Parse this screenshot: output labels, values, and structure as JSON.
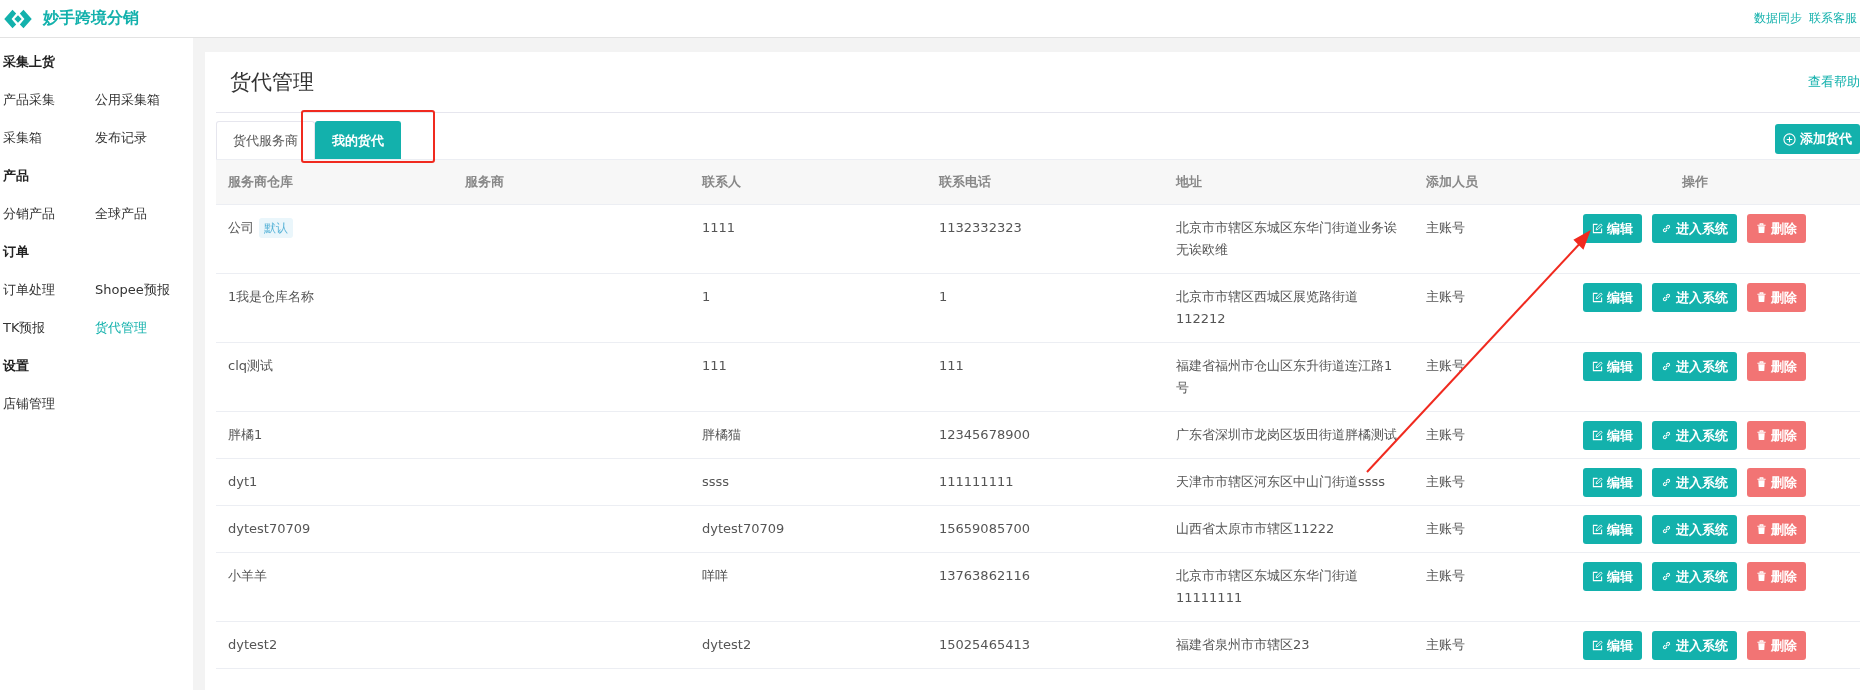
{
  "header": {
    "brand": "妙手跨境分销",
    "links": [
      "数据同步",
      "联系客服"
    ]
  },
  "sidebar": [
    {
      "title": "采集上货",
      "items": [
        {
          "label": "产品采集",
          "selected": false
        },
        {
          "label": "公用采集箱",
          "selected": false
        },
        {
          "label": "采集箱",
          "selected": false
        },
        {
          "label": "发布记录",
          "selected": false
        }
      ]
    },
    {
      "title": "产品",
      "items": [
        {
          "label": "分销产品",
          "selected": false
        },
        {
          "label": "全球产品",
          "selected": false
        }
      ]
    },
    {
      "title": "订单",
      "items": [
        {
          "label": "订单处理",
          "selected": false
        },
        {
          "label": "Shopee预报",
          "selected": false
        },
        {
          "label": "TK预报",
          "selected": false
        },
        {
          "label": "货代管理",
          "selected": true
        }
      ]
    },
    {
      "title": "设置",
      "items": [
        {
          "label": "店铺管理",
          "selected": false
        }
      ]
    }
  ],
  "page": {
    "title": "货代管理",
    "help_link": "查看帮助"
  },
  "tabs": [
    {
      "label": "货代服务商",
      "selected": false,
      "highlighted": false
    },
    {
      "label": "我的货代",
      "selected": true,
      "highlighted": true
    }
  ],
  "add_button": "添加货代",
  "table": {
    "columns": [
      "服务商仓库",
      "服务商",
      "联系人",
      "联系电话",
      "地址",
      "添加人员",
      "操作"
    ],
    "rows": [
      {
        "warehouse": "公司",
        "badge": "默认",
        "provider": "",
        "contact": "1111",
        "phone": "1132332323",
        "address": "北京市市辖区东城区东华门街道业务诶无诶欧维",
        "added_by": "主账号",
        "actions": [
          {
            "kind": "edit",
            "label": "编辑",
            "highlighted": true
          },
          {
            "kind": "enter",
            "label": "进入系统",
            "highlighted": false
          },
          {
            "kind": "delete",
            "label": "删除",
            "highlighted": false
          }
        ]
      },
      {
        "warehouse": "1我是仓库名称",
        "provider": "",
        "contact": "1",
        "phone": "1",
        "address": "北京市市辖区西城区展览路街道112212",
        "added_by": "主账号",
        "actions": [
          {
            "kind": "edit",
            "label": "编辑",
            "highlighted": false
          },
          {
            "kind": "enter",
            "label": "进入系统",
            "highlighted": false
          },
          {
            "kind": "delete",
            "label": "删除",
            "highlighted": false
          }
        ]
      },
      {
        "warehouse": "clq测试",
        "provider": "",
        "contact": "111",
        "phone": "111",
        "address": "福建省福州市仓山区东升街道连江路1号",
        "added_by": "主账号",
        "actions": [
          {
            "kind": "edit",
            "label": "编辑",
            "highlighted": false
          },
          {
            "kind": "enter",
            "label": "进入系统",
            "highlighted": false
          },
          {
            "kind": "delete",
            "label": "删除",
            "highlighted": false
          }
        ]
      },
      {
        "warehouse": "胖橘1",
        "provider": "",
        "contact": "胖橘猫",
        "phone": "12345678900",
        "address": "广东省深圳市龙岗区坂田街道胖橘测试",
        "added_by": "主账号",
        "actions": [
          {
            "kind": "edit",
            "label": "编辑",
            "highlighted": false
          },
          {
            "kind": "enter",
            "label": "进入系统",
            "highlighted": false
          },
          {
            "kind": "delete",
            "label": "删除",
            "highlighted": false
          }
        ]
      },
      {
        "warehouse": "dyt1",
        "provider": "",
        "contact": "ssss",
        "phone": "111111111",
        "address": "天津市市辖区河东区中山门街道ssss",
        "added_by": "主账号",
        "actions": [
          {
            "kind": "edit",
            "label": "编辑",
            "highlighted": false
          },
          {
            "kind": "enter",
            "label": "进入系统",
            "highlighted": false
          },
          {
            "kind": "delete",
            "label": "删除",
            "highlighted": false
          }
        ]
      },
      {
        "warehouse": "dytest70709",
        "provider": "",
        "contact": "dytest70709",
        "phone": "15659085700",
        "address": "山西省太原市市辖区11222",
        "added_by": "主账号",
        "actions": [
          {
            "kind": "edit",
            "label": "编辑",
            "highlighted": false
          },
          {
            "kind": "enter",
            "label": "进入系统",
            "highlighted": false
          },
          {
            "kind": "delete",
            "label": "删除",
            "highlighted": false
          }
        ]
      },
      {
        "warehouse": "小羊羊",
        "provider": "",
        "contact": "咩咩",
        "phone": "13763862116",
        "address": "北京市市辖区东城区东华门街道11111111",
        "added_by": "主账号",
        "actions": [
          {
            "kind": "edit",
            "label": "编辑",
            "highlighted": false
          },
          {
            "kind": "enter",
            "label": "进入系统",
            "highlighted": false
          },
          {
            "kind": "delete",
            "label": "删除",
            "highlighted": false
          }
        ]
      },
      {
        "warehouse": "dytest2",
        "provider": "",
        "contact": "dytest2",
        "phone": "15025465413",
        "address": "福建省泉州市市辖区23",
        "added_by": "主账号",
        "actions": [
          {
            "kind": "edit",
            "label": "编辑",
            "highlighted": false
          },
          {
            "kind": "enter",
            "label": "进入系统",
            "highlighted": false
          },
          {
            "kind": "delete",
            "label": "删除",
            "highlighted": false
          }
        ]
      }
    ]
  }
}
